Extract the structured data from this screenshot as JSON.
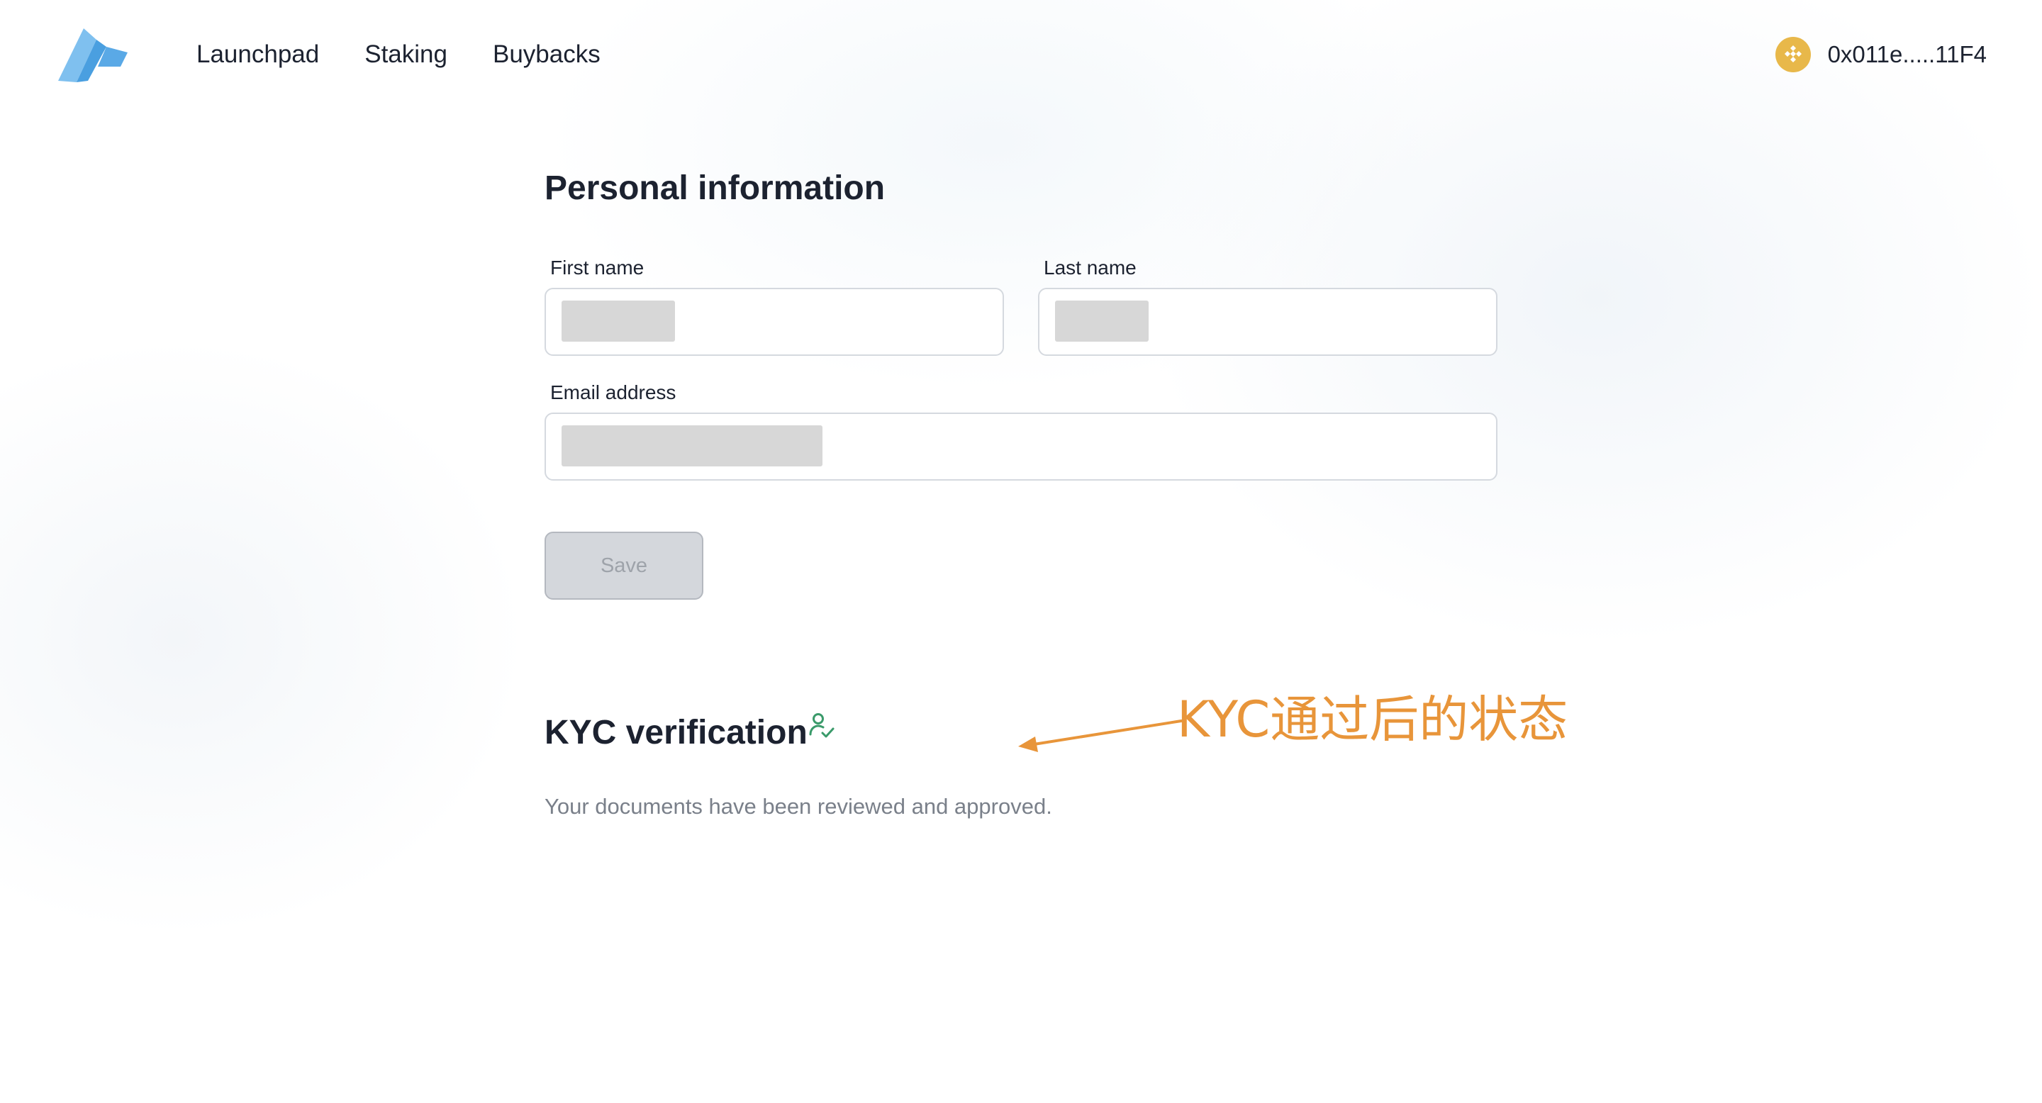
{
  "header": {
    "nav": [
      {
        "label": "Launchpad"
      },
      {
        "label": "Staking"
      },
      {
        "label": "Buybacks"
      }
    ],
    "wallet": {
      "address": "0x011e.....11F4",
      "coin_icon": "bnb-coin-icon"
    },
    "logo_icon": "app-logo-icon"
  },
  "personal_info": {
    "title": "Personal information",
    "first_name_label": "First name",
    "last_name_label": "Last name",
    "email_label": "Email address",
    "save_label": "Save"
  },
  "kyc": {
    "title": "KYC verification",
    "icon": "user-check-icon",
    "status_text": "Your documents have been reviewed and approved."
  },
  "annotation": {
    "text": "KYC通过后的状态"
  },
  "colors": {
    "logo": "#5aa9e6",
    "coin": "#e8b84a",
    "kyc_icon": "#3a9a6a",
    "annotation": "#e8953a",
    "save_bg": "#d4d7dc"
  }
}
